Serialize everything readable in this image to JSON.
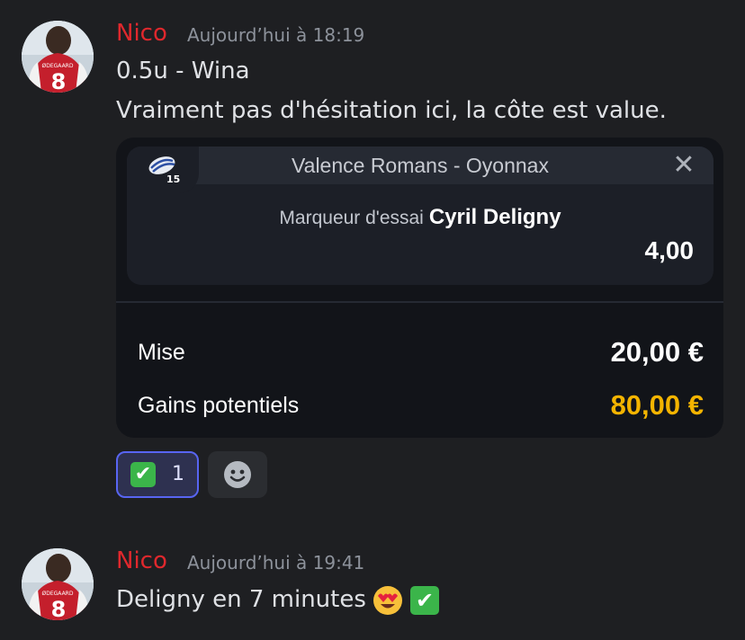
{
  "messages": [
    {
      "author": "Nico",
      "timestamp": "Aujourd’hui à 18:19",
      "lines": [
        "0.5u - Wina",
        "Vraiment pas d'hésitation ici, la côte est value."
      ],
      "bet_card": {
        "match": "Valence Romans - Oyonnax",
        "badge": "15",
        "market": "Marqueur d'essai",
        "selection": "Cyril Deligny",
        "odds": "4,00",
        "stake_label": "Mise",
        "stake_value": "20,00 €",
        "gains_label": "Gains potentiels",
        "gains_value": "80,00 €"
      },
      "reactions": [
        {
          "emoji": "white-check-mark",
          "glyph": "✔",
          "count": "1",
          "active": true
        },
        {
          "emoji": "add-reaction-smiley",
          "count": ""
        }
      ]
    },
    {
      "author": "Nico",
      "timestamp": "Aujourd’hui à 19:41",
      "text": "Deligny en 7 minutes",
      "emojis": [
        "heart-eyes-emoji",
        "white-check-mark"
      ],
      "check_glyph": "✔"
    }
  ],
  "avatar": {
    "jersey_number": "8",
    "jersey_name": "ØDEGAARD"
  },
  "colors": {
    "background": "#1e1f22",
    "author": "#e0282d",
    "timestamp": "#8d929b",
    "gains": "#f4b400",
    "reaction_active_border": "#5865f2",
    "check_green": "#3bb54a"
  }
}
